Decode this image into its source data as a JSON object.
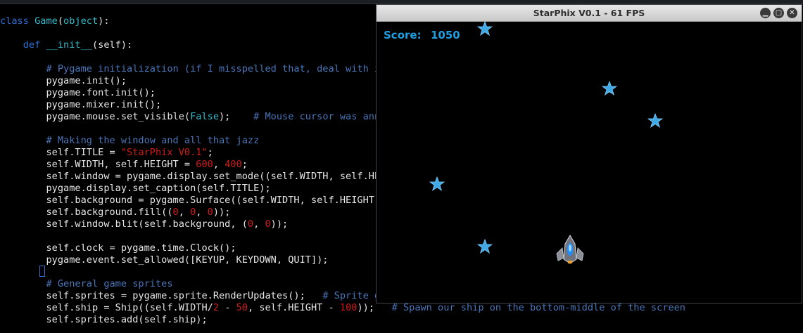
{
  "editor": {
    "lines": [
      [
        {
          "t": "class ",
          "c": "kw"
        },
        {
          "t": "Game",
          "c": "cls"
        },
        {
          "t": "(",
          "c": ""
        },
        {
          "t": "object",
          "c": "cls"
        },
        {
          "t": "):",
          "c": ""
        }
      ],
      [],
      [
        {
          "t": "    ",
          "c": ""
        },
        {
          "t": "def ",
          "c": "kw"
        },
        {
          "t": "__init__",
          "c": "cls"
        },
        {
          "t": "(self):",
          "c": ""
        }
      ],
      [],
      [
        {
          "t": "        # Pygame initialization (if I misspelled that, deal with it",
          "c": "cm"
        }
      ],
      [
        {
          "t": "        pygame.init();",
          "c": ""
        }
      ],
      [
        {
          "t": "        pygame.font.init();",
          "c": ""
        }
      ],
      [
        {
          "t": "        pygame.mixer.init();",
          "c": ""
        }
      ],
      [
        {
          "t": "        pygame.mouse.set_visible(",
          "c": ""
        },
        {
          "t": "False",
          "c": "bool"
        },
        {
          "t": ");    ",
          "c": ""
        },
        {
          "t": "# Mouse cursor was anno",
          "c": "cm"
        }
      ],
      [],
      [
        {
          "t": "        # Making the window and all that jazz",
          "c": "cm"
        }
      ],
      [
        {
          "t": "        self.TITLE = ",
          "c": ""
        },
        {
          "t": "\"StarPhix V0.1\"",
          "c": "str"
        },
        {
          "t": ";",
          "c": ""
        }
      ],
      [
        {
          "t": "        self.WIDTH, self.HEIGHT = ",
          "c": ""
        },
        {
          "t": "600",
          "c": "num"
        },
        {
          "t": ", ",
          "c": ""
        },
        {
          "t": "400",
          "c": "num"
        },
        {
          "t": ";",
          "c": ""
        }
      ],
      [
        {
          "t": "        self.window = pygame.display.set_mode((self.WIDTH, self.HEI",
          "c": ""
        }
      ],
      [
        {
          "t": "        pygame.display.set_caption(self.TITLE);",
          "c": ""
        }
      ],
      [
        {
          "t": "        self.background = pygame.Surface((self.WIDTH, self.HEIGHT))",
          "c": ""
        }
      ],
      [
        {
          "t": "        self.background.fill((",
          "c": ""
        },
        {
          "t": "0",
          "c": "num"
        },
        {
          "t": ", ",
          "c": ""
        },
        {
          "t": "0",
          "c": "num"
        },
        {
          "t": ", ",
          "c": ""
        },
        {
          "t": "0",
          "c": "num"
        },
        {
          "t": "));",
          "c": ""
        }
      ],
      [
        {
          "t": "        self.window.blit(self.background, (",
          "c": ""
        },
        {
          "t": "0",
          "c": "num"
        },
        {
          "t": ", ",
          "c": ""
        },
        {
          "t": "0",
          "c": "num"
        },
        {
          "t": "));",
          "c": ""
        }
      ],
      [],
      [
        {
          "t": "        self.clock = pygame.time.Clock();",
          "c": ""
        }
      ],
      [
        {
          "t": "        pygame.event.set_allowed([KEYUP, KEYDOWN, QUIT]);",
          "c": ""
        }
      ],
      [],
      [
        {
          "t": "        # General game sprites",
          "c": "cm"
        }
      ],
      [
        {
          "t": "        self.sprites = pygame.sprite.RenderUpdates();   ",
          "c": ""
        },
        {
          "t": "# Sprite gr",
          "c": "cm"
        }
      ],
      [
        {
          "t": "        self.ship = Ship((self.WIDTH/",
          "c": ""
        },
        {
          "t": "2",
          "c": "num"
        },
        {
          "t": " - ",
          "c": ""
        },
        {
          "t": "50",
          "c": "num"
        },
        {
          "t": ", self.HEIGHT - ",
          "c": ""
        },
        {
          "t": "100",
          "c": "num"
        },
        {
          "t": "));   ",
          "c": ""
        },
        {
          "t": "# Spawn our ship on the bottom-middle of the screen",
          "c": "cm"
        }
      ],
      [
        {
          "t": "        self.sprites.add(self.ship);",
          "c": ""
        }
      ]
    ]
  },
  "window": {
    "title": "StarPhix V0.1 - 61 FPS",
    "buttons": [
      "minimize-icon",
      "maximize-icon",
      "close-icon"
    ],
    "button_glyphs": [
      "▁",
      "▢",
      "✕"
    ]
  },
  "game": {
    "score_label": "Score:",
    "score_value": "1050",
    "star_color": "#3fa9e6",
    "background": "#000000"
  },
  "colors": {
    "keyword": "#2f6fd6",
    "class_name": "#35b8c6",
    "string": "#d21c1c",
    "comment": "#4a75b8",
    "score": "#1f9ee0"
  }
}
